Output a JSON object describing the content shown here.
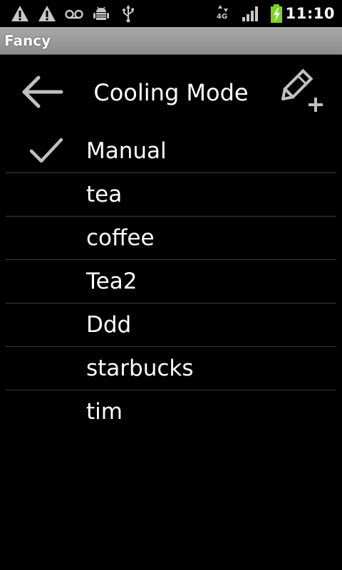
{
  "status_bar": {
    "time": "11:10",
    "network_label": "4G",
    "icons": [
      "warning-icon",
      "warning-icon",
      "voicemail-icon",
      "android-debug-icon",
      "usb-icon",
      "network-4g-icon",
      "signal-icon",
      "battery-charging-icon"
    ],
    "battery_color": "#7ed321"
  },
  "app": {
    "title": "Fancy"
  },
  "header": {
    "title": "Cooling Mode",
    "back_icon": "arrow-left-icon",
    "add_icon": "edit-add-icon"
  },
  "list": {
    "selected_index": 0,
    "items": [
      {
        "label": "Manual",
        "selected": true
      },
      {
        "label": "tea",
        "selected": false
      },
      {
        "label": "coffee",
        "selected": false
      },
      {
        "label": "Tea2",
        "selected": false
      },
      {
        "label": "Ddd",
        "selected": false
      },
      {
        "label": "starbucks",
        "selected": false
      },
      {
        "label": "tim",
        "selected": false
      }
    ]
  },
  "colors": {
    "background": "#000000",
    "text": "#ffffff",
    "title_bar": "#9a9a9a",
    "divider": "#3c3c3c"
  }
}
